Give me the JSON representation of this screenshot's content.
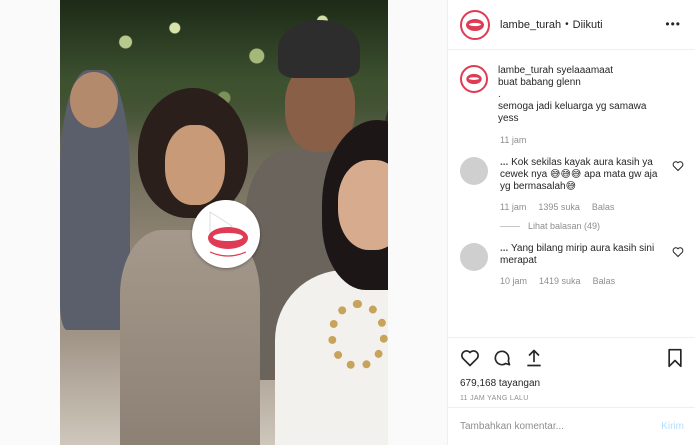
{
  "header": {
    "username": "lambe_turah",
    "separator": "•",
    "follow_label": "Diikuti",
    "more_label": "•••"
  },
  "caption": {
    "username": "lambe_turah",
    "lines": [
      "syelaaamaat",
      "buat babang glenn",
      ".",
      "semoga jadi keluarga yg samawa",
      "yess"
    ],
    "age": "11 jam"
  },
  "comments": [
    {
      "username": "...",
      "text": "Kok sekilas kayak aura kasih ya cewek nya 😅😅😅 apa mata gw aja yg bermasalah😅",
      "age": "11 jam",
      "likes": "1395 suka",
      "reply_label": "Balas",
      "view_replies": "Lihat balasan (49)"
    },
    {
      "username": "...",
      "text": "Yang bilang mirip aura kasih sini merapat",
      "age": "10 jam",
      "likes": "1419 suka",
      "reply_label": "Balas"
    }
  ],
  "stats": {
    "views": "679,168 tayangan",
    "posted": "11 JAM YANG LALU"
  },
  "add_comment": {
    "placeholder": "Tambahkan komentar...",
    "send_label": "Kirim"
  },
  "colors": {
    "brand_red": "#e03b55",
    "muted": "#8e8e8e",
    "send_disabled": "#b2dffc"
  },
  "icons": [
    "heart-icon",
    "comment-icon",
    "share-icon",
    "bookmark-icon",
    "more-icon",
    "play-badge-icon"
  ]
}
